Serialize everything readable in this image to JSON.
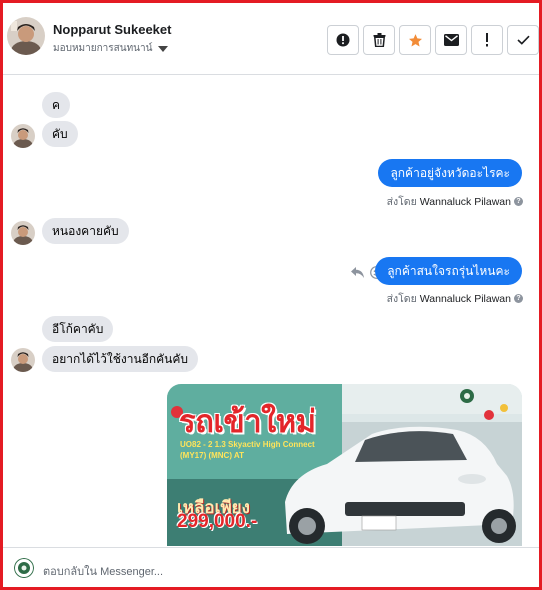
{
  "header": {
    "contact_name": "Nopparut Sukeeket",
    "assign_label": "มอบหมายการสนทนาน์",
    "actions": [
      {
        "icon": "alert-circle-icon"
      },
      {
        "icon": "trash-icon"
      },
      {
        "icon": "star-icon"
      },
      {
        "icon": "envelope-icon"
      },
      {
        "icon": "exclamation-icon"
      },
      {
        "icon": "check-icon"
      }
    ]
  },
  "messages": {
    "in_1": "ค",
    "in_2": "คับ",
    "out_1": "ลูกค้าอยู่จังหวัดอะไรคะ",
    "in_3": "หนองคายคับ",
    "out_2": "ลูกค้าสนใจรถรุ่นไหนคะ",
    "in_4": "อีโก้คาคับ",
    "in_5": "อยากได้ไว้ใช้งานอีกคันคับ"
  },
  "sent_by": {
    "prefix": "ส่งโดย",
    "agent": "Wannaluck Pilawan"
  },
  "promo": {
    "title": "รถเข้าใหม่",
    "model_line_1": "UO82 - 2 1.3 Skyactiv High Connect",
    "model_line_2": "(MY17) (MNC) AT",
    "only_label": "เหลือเพียง",
    "price": "299,000.-"
  },
  "composer": {
    "placeholder": "ตอบกลับใน Messenger..."
  },
  "colors": {
    "outgoing_bubble": "#1877f2",
    "incoming_bubble": "#e4e6eb",
    "star": "#f28c38",
    "frame": "#e41b23"
  }
}
